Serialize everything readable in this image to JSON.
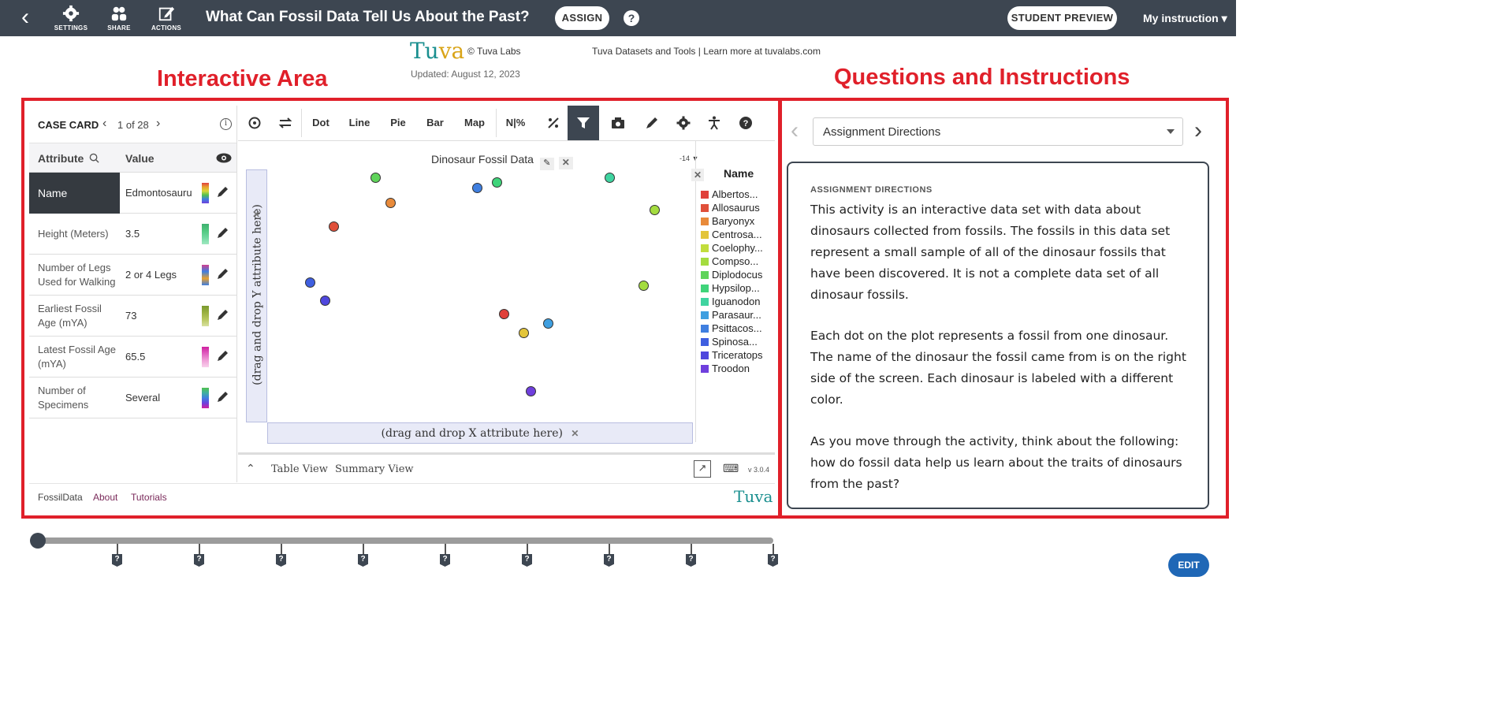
{
  "topbar": {
    "back_icon": "arrow-left-icon",
    "settings_label": "SETTINGS",
    "share_label": "SHARE",
    "actions_label": "ACTIONS",
    "title": "What Can Fossil Data Tell Us About the Past?",
    "assign_label": "ASSIGN",
    "help_label": "?",
    "student_preview_label": "STUDENT PREVIEW",
    "my_instruction_label": "My instruction",
    "bg_color": "#3d4651"
  },
  "header": {
    "logo_tu": "Tu",
    "logo_va": "va",
    "copyright": "© Tuva Labs",
    "updated": "Updated: August 12, 2023",
    "tagline": "Tuva Datasets and Tools | Learn more at tuvalabs.com"
  },
  "annotations": {
    "left_heading": "Interactive Area",
    "right_heading": "Questions and Instructions",
    "color": "#e0202a"
  },
  "case_card": {
    "label": "CASE CARD",
    "count": "1 of 28",
    "attr_header": "Attribute",
    "value_header": "Value",
    "rows": [
      {
        "attr": "Name",
        "value": "Edmontosaurus"
      },
      {
        "attr": "Height (Meters)",
        "value": "3.5"
      },
      {
        "attr": "Number of Legs Used for Walking",
        "value": "2 or 4 Legs"
      },
      {
        "attr": "Earliest Fossil Age (mYA)",
        "value": "73"
      },
      {
        "attr": "Latest Fossil Age (mYA)",
        "value": "65.5"
      },
      {
        "attr": "Number of Specimens",
        "value": "Several"
      }
    ]
  },
  "footer": {
    "dataset": "FossilData",
    "about": "About",
    "tutorials": "Tutorials",
    "logo": "Tuva"
  },
  "toolbar": {
    "dot": "Dot",
    "line": "Line",
    "pie": "Pie",
    "bar": "Bar",
    "map": "Map",
    "count_pct": "N|%"
  },
  "plot": {
    "title": "Dinosaur Fossil Data",
    "filter_count": "-14",
    "y_drop": "(drag and drop Y attribute here)",
    "x_drop": "(drag and drop X attribute here)",
    "legend_title": "Name",
    "legend": [
      {
        "name": "Albertos...",
        "color": "#e0403a"
      },
      {
        "name": "Allosaurus",
        "color": "#e0503a"
      },
      {
        "name": "Baryonyx",
        "color": "#e88a3a"
      },
      {
        "name": "Centrosa...",
        "color": "#e3c53a"
      },
      {
        "name": "Coelophy...",
        "color": "#c2dd3c"
      },
      {
        "name": "Compso...",
        "color": "#a4dc3f"
      },
      {
        "name": "Diplodocus",
        "color": "#5fd45a"
      },
      {
        "name": "Hypsilop...",
        "color": "#3fd47a"
      },
      {
        "name": "Iguanodon",
        "color": "#3fd4a0"
      },
      {
        "name": "Parasaur...",
        "color": "#3f9fe0"
      },
      {
        "name": "Psittacos...",
        "color": "#3f7fe0"
      },
      {
        "name": "Spinosa...",
        "color": "#3f5fe0"
      },
      {
        "name": "Triceratops",
        "color": "#4f47dd"
      },
      {
        "name": "Troodon",
        "color": "#6f3fdd"
      }
    ],
    "table_view": "Table View",
    "summary_view": "Summary View",
    "version": "v 3.0.4"
  },
  "questions": {
    "dropdown_value": "Assignment Directions",
    "caption": "ASSIGNMENT DIRECTIONS",
    "paragraph1": "This activity is an interactive data set with data about dinosaurs collected from fossils. The fossils in this data set represent a small sample of all of the dinosaur fossils that have been discovered. It is not a complete data set of all dinosaur fossils.",
    "paragraph2": "Each dot on the plot represents a fossil from one dinosaur. The name of the dinosaur the fossil came from is on the right side of the screen. Each dinosaur is labeled with a different color.",
    "paragraph3": "As you move through the activity, think about the following: how do fossil data help us learn about the traits of dinosaurs from the past?"
  },
  "timeline": {
    "marker_label": "?",
    "edit_label": "EDIT"
  }
}
